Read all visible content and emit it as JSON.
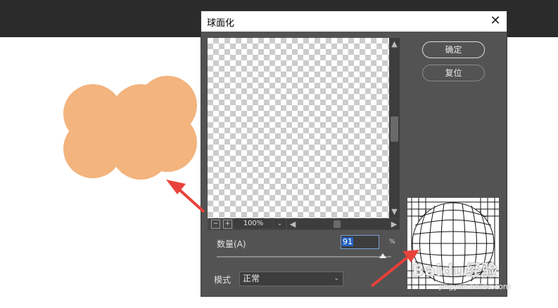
{
  "dialog": {
    "title": "球面化",
    "close_icon": "close-icon",
    "ok_label": "确定",
    "reset_label": "复位"
  },
  "preview": {
    "zoom": "100%",
    "zoom_out_icon": "minus-icon",
    "zoom_in_icon": "plus-icon"
  },
  "amount": {
    "label": "数量(A)",
    "value": "91",
    "unit": "%",
    "slider_percent": 91
  },
  "mode": {
    "label": "模式",
    "selected": "正常"
  },
  "colors": {
    "shape_fill": "#f3b47e",
    "arrow": "#e8413a",
    "dialog_bg": "#535353"
  },
  "watermark": {
    "text": "Baidu经验",
    "url": "jingyan.baidu.com"
  }
}
